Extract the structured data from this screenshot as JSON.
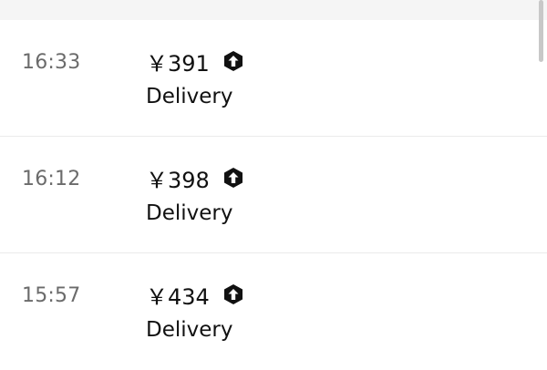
{
  "trips": [
    {
      "time": "16:33",
      "amount": "￥391",
      "type": "Delivery",
      "icon": "boost-arrow-icon"
    },
    {
      "time": "16:12",
      "amount": "￥398",
      "type": "Delivery",
      "icon": "boost-arrow-icon"
    },
    {
      "time": "15:57",
      "amount": "￥434",
      "type": "Delivery",
      "icon": "boost-arrow-icon"
    }
  ],
  "colors": {
    "text_primary": "#111111",
    "text_secondary": "#6b6b6b",
    "divider": "#ebebeb",
    "top_strip": "#f5f5f5"
  }
}
